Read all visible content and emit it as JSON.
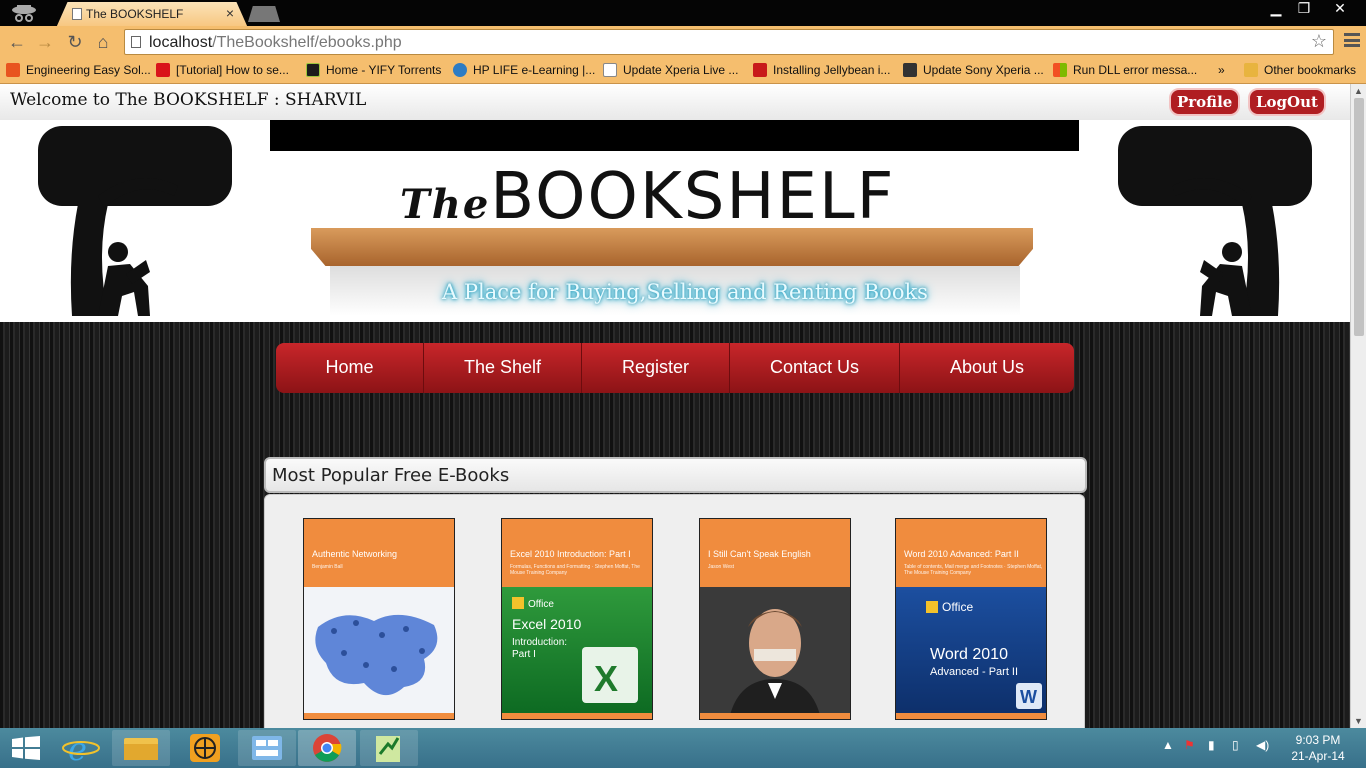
{
  "browser": {
    "tab_title": "The BOOKSHELF",
    "tab_close": "×",
    "window_buttons": [
      "▁",
      "❐",
      "✕"
    ],
    "url_host": "localhost",
    "url_path": "/TheBookshelf/ebooks.php",
    "nav_back": "←",
    "nav_forward": "→",
    "nav_reload": "↻",
    "nav_home": "⌂",
    "star": "☆",
    "bookmarks": [
      {
        "label": "Engineering Easy Sol...",
        "color": "#e8541f"
      },
      {
        "label": "[Tutorial] How to se...",
        "color": "#d9141a"
      },
      {
        "label": "Home - YIFY Torrents",
        "color": "#1c1c1c"
      },
      {
        "label": "HP LIFE e-Learning |...",
        "color": "#2d7cc4"
      },
      {
        "label": "Update Xperia Live ...",
        "color": "#ffffff"
      },
      {
        "label": "Installing Jellybean i...",
        "color": "#c81a1a"
      },
      {
        "label": "Update Sony Xperia ...",
        "color": "#333333"
      },
      {
        "label": "Run DLL error messa...",
        "color": "#f0a020"
      }
    ],
    "bookmarks_overflow": "»",
    "other_bookmarks": "Other bookmarks"
  },
  "site": {
    "welcome": "Welcome to The BOOKSHELF : SHARVIL",
    "profile_label": "Profile",
    "logout_label": "LogOut",
    "logo_the": "The",
    "logo_word": "BOOKSHELF",
    "tagline": "A Place for Buying,Selling and Renting Books",
    "nav": [
      "Home",
      "The Shelf",
      "Register",
      "Contact Us",
      "About Us"
    ],
    "section_title": "Most Popular Free E-Books",
    "books": [
      {
        "title": "Authentic Networking",
        "subtitle": "Benjamin Ball"
      },
      {
        "title": "Excel 2010 Introduction: Part I",
        "subtitle": "Formulas, Functions and Formatting · Stephen Moffat, The Mouse Training Company"
      },
      {
        "title": "I Still Can't Speak English",
        "subtitle": "Jason West"
      },
      {
        "title": "Word 2010 Advanced: Part II",
        "subtitle": "Table of contents, Mail merge and Footnotes · Stephen Moffat, The Mouse Training Company"
      }
    ]
  },
  "taskbar": {
    "time": "9:03 PM",
    "date": "21-Apr-14"
  },
  "colors": {
    "brand_red": "#b01e22",
    "chrome_orange": "#f5be6e",
    "taskbar": "#3f7b92"
  }
}
